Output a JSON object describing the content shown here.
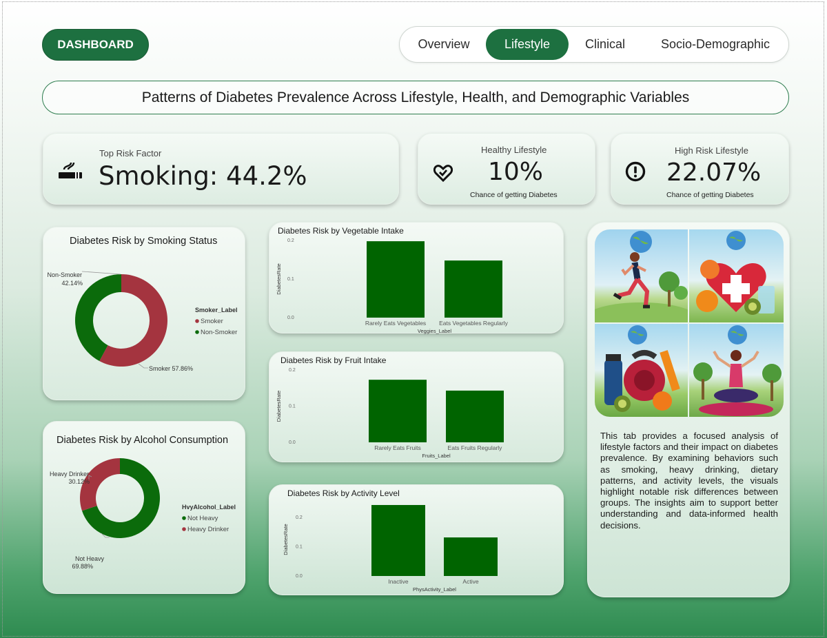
{
  "header": {
    "dashboard_label": "DASHBOARD",
    "tabs": [
      {
        "label": "Overview",
        "active": false
      },
      {
        "label": "Lifestyle",
        "active": true
      },
      {
        "label": "Clinical",
        "active": false
      },
      {
        "label": "Socio-Demographic",
        "active": false
      }
    ]
  },
  "title": "Patterns of Diabetes Prevalence Across Lifestyle, Health, and  Demographic Variables",
  "kpis": {
    "top_risk": {
      "label": "Top Risk Factor",
      "value": "Smoking: 44.2%",
      "icon": "cigarette-icon"
    },
    "healthy": {
      "label": "Healthy Lifestyle",
      "value": "10%",
      "sub": "Chance of getting Diabetes",
      "icon": "heart-check-icon"
    },
    "high_risk": {
      "label": "High Risk Lifestyle",
      "value": "22.07%",
      "sub": "Chance of getting Diabetes",
      "icon": "alert-circle-icon"
    }
  },
  "colors": {
    "accent": "#1d7040",
    "bar": "#006400",
    "donut_red": "#a4343f",
    "donut_green": "#0b6b0b"
  },
  "chart_data": [
    {
      "type": "pie",
      "title": "Diabetes Risk by Smoking Status",
      "legend_title": "Smoker_Label",
      "legend_position": "right",
      "slices": [
        {
          "name": "Smoker",
          "value": 57.86,
          "label": "Smoker 57.86%",
          "color": "#a4343f"
        },
        {
          "name": "Non-Smoker",
          "value": 42.14,
          "label_name": "Non-Smoker",
          "label_value": "42.14%",
          "color": "#0b6b0b"
        }
      ],
      "legend": [
        {
          "name": "Smoker",
          "color": "#a4343f"
        },
        {
          "name": "Non-Smoker",
          "color": "#0b6b0b"
        }
      ]
    },
    {
      "type": "pie",
      "title": "Diabetes Risk by Alcohol Consumption",
      "legend_title": "HvyAlcohol_Label",
      "legend_position": "right",
      "slices": [
        {
          "name": "Not Heavy",
          "value": 69.88,
          "label_name": "Not Heavy",
          "label_value": "69.88%",
          "color": "#0b6b0b"
        },
        {
          "name": "Heavy Drinker",
          "value": 30.12,
          "label_name": "Heavy Drinker",
          "label_value": "30.12%",
          "color": "#a4343f"
        }
      ],
      "legend": [
        {
          "name": "Not Heavy",
          "color": "#0b6b0b"
        },
        {
          "name": "Heavy Drinker",
          "color": "#a4343f"
        }
      ]
    },
    {
      "type": "bar",
      "title": "Diabetes Risk by Vegetable Intake",
      "xlabel": "Veggies_Label",
      "ylabel": "DiabetesRate",
      "categories": [
        "Rarely Eats Vegetables",
        "Eats Vegetables Regularly"
      ],
      "values": [
        0.198,
        0.148
      ],
      "ylim": [
        0,
        0.2
      ],
      "yticks": [
        "0.0",
        "0.1",
        "0.2"
      ]
    },
    {
      "type": "bar",
      "title": "Diabetes Risk by Fruit Intake",
      "xlabel": "Fruits_Label",
      "ylabel": "DiabetesRate",
      "categories": [
        "Rarely Eats Fruits",
        "Eats Fruits Regularly"
      ],
      "values": [
        0.173,
        0.143
      ],
      "ylim": [
        0,
        0.2
      ],
      "yticks": [
        "0.0",
        "0.1",
        "0.2"
      ]
    },
    {
      "type": "bar",
      "title": "Diabetes Risk by Activity Level",
      "xlabel": "PhysActivity_Label",
      "ylabel": "DiabetesRate",
      "categories": [
        "Inactive",
        "Active"
      ],
      "values": [
        0.243,
        0.132
      ],
      "ylim": [
        0,
        0.25
      ],
      "yticks": [
        "0.0",
        "0.1",
        "0.2"
      ]
    }
  ],
  "description": "This tab provides a focused analysis of lifestyle factors and their impact on diabetes prevalence. By examining behaviors such as smoking, heavy drinking, dietary patterns, and activity levels, the visuals highlight notable risk differences between groups. The insights aim to support better understanding and data-informed health decisions."
}
